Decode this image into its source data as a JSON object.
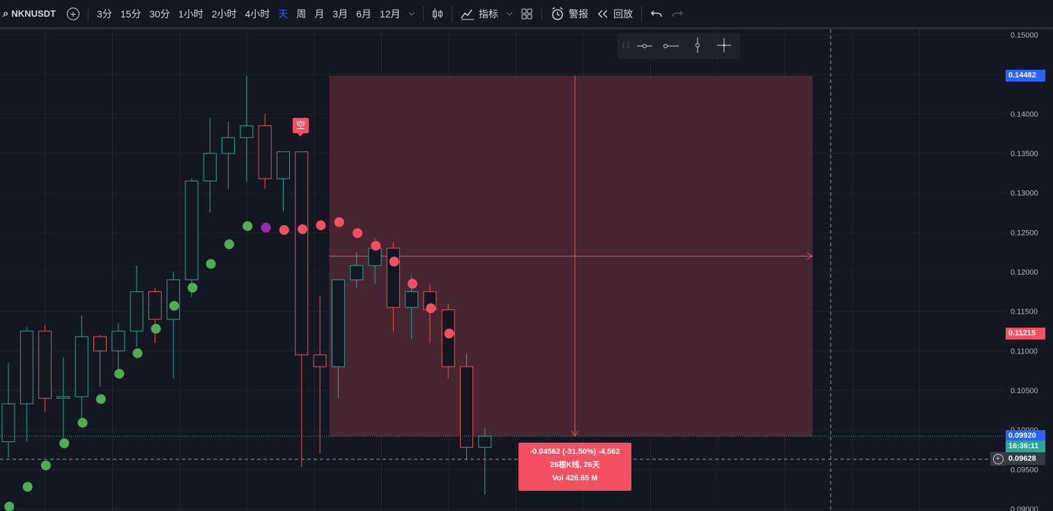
{
  "toolbar": {
    "symbol": "NKNUSDT",
    "intervals": [
      "3分",
      "15分",
      "30分",
      "1小时",
      "2小时",
      "4小时",
      "天",
      "周",
      "月",
      "3月",
      "6月",
      "12月"
    ],
    "active_interval": "天",
    "indicators_label": "指标",
    "alert_label": "警报",
    "replay_label": "回放"
  },
  "price_axis": {
    "ticks": [
      "0.15000",
      "0.14500",
      "0.14000",
      "0.13500",
      "0.13000",
      "0.12500",
      "0.12000",
      "0.11500",
      "0.11000",
      "0.10500",
      "0.10000",
      "0.09500",
      "0.09000"
    ],
    "top_label": "0.14482",
    "stop_label": "0.11215",
    "last_price_label": "0.09920",
    "countdown_label": "16:36:11",
    "crosshair_label": "0.09628"
  },
  "colors": {
    "up": "#26a69a",
    "down": "#ef5350",
    "sar_up": "#4caf50",
    "sar_down": "#f55061",
    "sar_flip": "#9c27b0",
    "zone": "#4a2633",
    "blue_tag": "#2962ff",
    "red_tag": "#f55061"
  },
  "short_position_label": "空",
  "measure_tooltip": {
    "line1": "-0.04562 (-31.50%) -4,562",
    "line2": "26根K线, 26天",
    "line3": "Vol 426.65 M"
  },
  "chart_data": {
    "type": "candlestick",
    "ylim": [
      0.09,
      0.15
    ],
    "candles": [
      {
        "o": 0.0985,
        "h": 0.1085,
        "l": 0.0965,
        "c": 0.1033
      },
      {
        "o": 0.1033,
        "h": 0.113,
        "l": 0.0985,
        "c": 0.1125
      },
      {
        "o": 0.1125,
        "h": 0.1133,
        "l": 0.1023,
        "c": 0.104
      },
      {
        "o": 0.104,
        "h": 0.1092,
        "l": 0.0977,
        "c": 0.1042
      },
      {
        "o": 0.1042,
        "h": 0.1145,
        "l": 0.1012,
        "c": 0.1118
      },
      {
        "o": 0.1118,
        "h": 0.112,
        "l": 0.1055,
        "c": 0.11
      },
      {
        "o": 0.11,
        "h": 0.1135,
        "l": 0.107,
        "c": 0.1125
      },
      {
        "o": 0.1125,
        "h": 0.1208,
        "l": 0.1105,
        "c": 0.1175
      },
      {
        "o": 0.1175,
        "h": 0.118,
        "l": 0.111,
        "c": 0.114
      },
      {
        "o": 0.114,
        "h": 0.12,
        "l": 0.1065,
        "c": 0.119
      },
      {
        "o": 0.119,
        "h": 0.1318,
        "l": 0.1168,
        "c": 0.1315
      },
      {
        "o": 0.1315,
        "h": 0.1395,
        "l": 0.1275,
        "c": 0.135
      },
      {
        "o": 0.135,
        "h": 0.139,
        "l": 0.1305,
        "c": 0.137
      },
      {
        "o": 0.137,
        "h": 0.1448,
        "l": 0.1314,
        "c": 0.1385
      },
      {
        "o": 0.1385,
        "h": 0.14,
        "l": 0.1305,
        "c": 0.1318
      },
      {
        "o": 0.1318,
        "h": 0.1353,
        "l": 0.1277,
        "c": 0.1352
      },
      {
        "o": 0.1352,
        "h": 0.1352,
        "l": 0.0953,
        "c": 0.1095
      },
      {
        "o": 0.1095,
        "h": 0.117,
        "l": 0.097,
        "c": 0.108
      },
      {
        "o": 0.108,
        "h": 0.119,
        "l": 0.104,
        "c": 0.119
      },
      {
        "o": 0.119,
        "h": 0.1225,
        "l": 0.118,
        "c": 0.1208
      },
      {
        "o": 0.1208,
        "h": 0.1243,
        "l": 0.1185,
        "c": 0.123
      },
      {
        "o": 0.123,
        "h": 0.1238,
        "l": 0.1125,
        "c": 0.1155
      },
      {
        "o": 0.1155,
        "h": 0.1195,
        "l": 0.1115,
        "c": 0.1175
      },
      {
        "o": 0.1175,
        "h": 0.1185,
        "l": 0.111,
        "c": 0.1152
      },
      {
        "o": 0.1152,
        "h": 0.116,
        "l": 0.1065,
        "c": 0.108
      },
      {
        "o": 0.108,
        "h": 0.1097,
        "l": 0.0962,
        "c": 0.0978
      },
      {
        "o": 0.0978,
        "h": 0.1003,
        "l": 0.0918,
        "c": 0.0992
      }
    ],
    "sar": [
      {
        "i": 1,
        "v": 0.0903,
        "d": "up"
      },
      {
        "i": 2,
        "v": 0.0928,
        "d": "up"
      },
      {
        "i": 3,
        "v": 0.0955,
        "d": "up"
      },
      {
        "i": 4,
        "v": 0.0983,
        "d": "up"
      },
      {
        "i": 5,
        "v": 0.1009,
        "d": "up"
      },
      {
        "i": 6,
        "v": 0.1039,
        "d": "up"
      },
      {
        "i": 7,
        "v": 0.1071,
        "d": "up"
      },
      {
        "i": 8,
        "v": 0.1097,
        "d": "up"
      },
      {
        "i": 9,
        "v": 0.1128,
        "d": "up"
      },
      {
        "i": 10,
        "v": 0.1157,
        "d": "up"
      },
      {
        "i": 11,
        "v": 0.118,
        "d": "up"
      },
      {
        "i": 12,
        "v": 0.121,
        "d": "up"
      },
      {
        "i": 13,
        "v": 0.1235,
        "d": "up"
      },
      {
        "i": 14,
        "v": 0.1258,
        "d": "up"
      },
      {
        "i": 15,
        "v": 0.1256,
        "d": "flip"
      },
      {
        "i": 16,
        "v": 0.1253,
        "d": "down"
      },
      {
        "i": 17,
        "v": 0.1254,
        "d": "down"
      },
      {
        "i": 18,
        "v": 0.1259,
        "d": "down"
      },
      {
        "i": 19,
        "v": 0.1263,
        "d": "down"
      },
      {
        "i": 20,
        "v": 0.1249,
        "d": "down"
      },
      {
        "i": 21,
        "v": 0.1233,
        "d": "down"
      },
      {
        "i": 22,
        "v": 0.1213,
        "d": "down"
      },
      {
        "i": 23,
        "v": 0.1185,
        "d": "down"
      },
      {
        "i": 24,
        "v": 0.1154,
        "d": "down"
      },
      {
        "i": 25,
        "v": 0.1122,
        "d": "down"
      }
    ],
    "position": {
      "entry": 0.122,
      "target": 0.0992,
      "stop": 0.14482,
      "start_index": 18
    },
    "last_price": 0.0992,
    "crosshair_price": 0.09628
  }
}
